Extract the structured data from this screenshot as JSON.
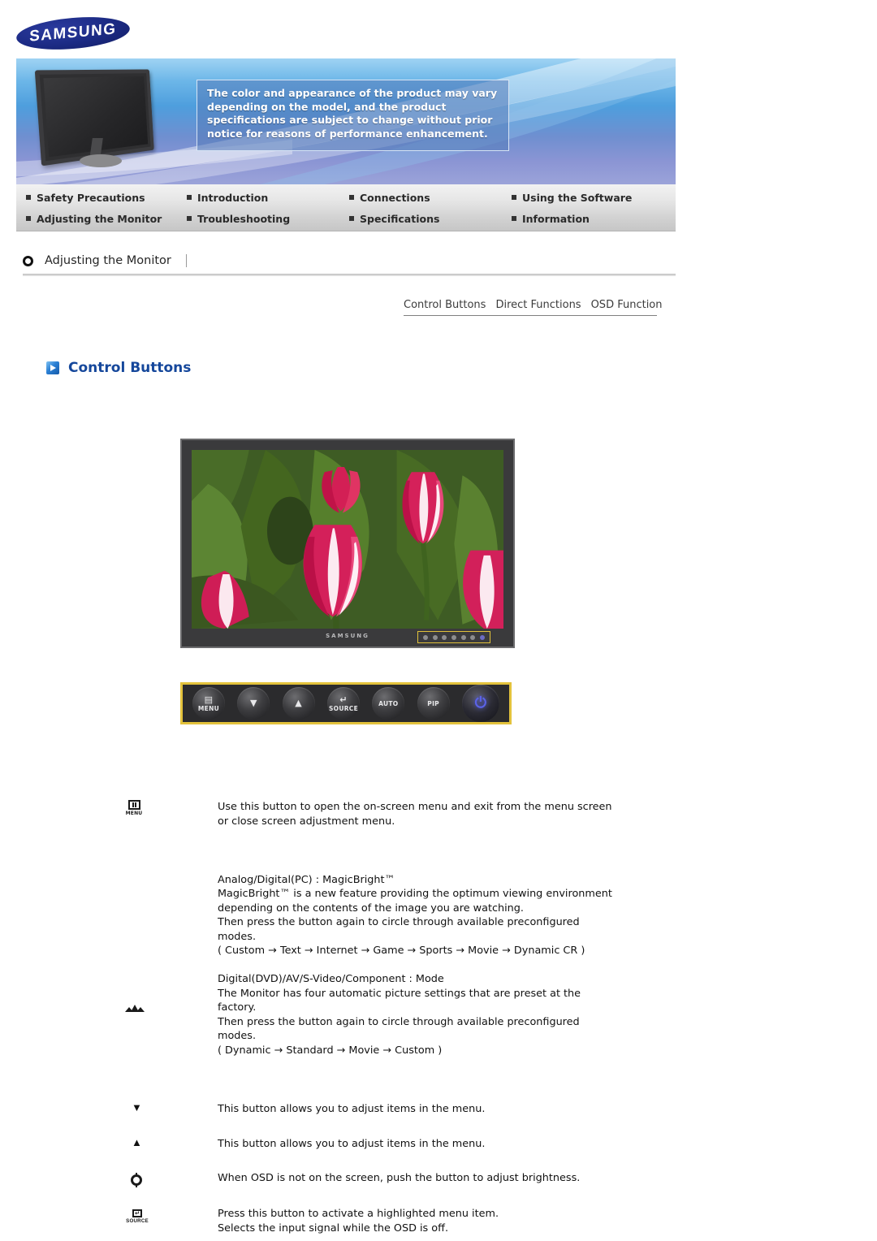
{
  "brand": {
    "logo_text": "SAMSUNG"
  },
  "banner": {
    "notice_lines": [
      "The color and appearance of the product may vary",
      "depending on the model, and the product",
      "specifications are subject to change without prior",
      "notice for reasons of performance enhancement."
    ]
  },
  "topnav": {
    "row1": [
      {
        "label": "Safety Precautions"
      },
      {
        "label": "Introduction"
      },
      {
        "label": "Connections"
      },
      {
        "label": "Using the Software"
      }
    ],
    "row2": [
      {
        "label": "Adjusting the Monitor"
      },
      {
        "label": "Troubleshooting"
      },
      {
        "label": "Specifications"
      },
      {
        "label": "Information"
      }
    ]
  },
  "section": {
    "title": "Adjusting the Monitor"
  },
  "subtabs": [
    {
      "label": "Control Buttons"
    },
    {
      "label": "Direct Functions"
    },
    {
      "label": "OSD Function"
    }
  ],
  "page": {
    "heading": "Control Buttons"
  },
  "monitor_photo": {
    "brand_label": "SAMSUNG"
  },
  "control_panel": {
    "buttons": [
      {
        "name": "menu",
        "glyph": "▤",
        "label": "MENU"
      },
      {
        "name": "down",
        "glyph": "▼",
        "label": ""
      },
      {
        "name": "up",
        "glyph": "▲",
        "label": ""
      },
      {
        "name": "source",
        "glyph": "↵",
        "label": "SOURCE"
      },
      {
        "name": "auto",
        "glyph": "",
        "label": "AUTO"
      },
      {
        "name": "pip",
        "glyph": "",
        "label": "PIP"
      },
      {
        "name": "power",
        "glyph": "⏻",
        "label": ""
      }
    ]
  },
  "descriptions": [
    {
      "icon": "menu-icon",
      "icon_label": "MENU",
      "lines": [
        "Use this button to open the on-screen menu and exit from the menu screen",
        "or close screen adjustment menu."
      ]
    },
    {
      "icon": "magicbright-icon",
      "block1": [
        "Analog/Digital(PC) : MagicBright™",
        "MagicBright™ is a new feature providing the optimum viewing environment",
        "depending on the contents of the image you are watching.",
        "Then press the button again to circle through available preconfigured",
        "modes.",
        "( Custom → Text → Internet → Game → Sports → Movie → Dynamic CR )"
      ],
      "block2": [
        "Digital(DVD)/AV/S-Video/Component : Mode",
        "The Monitor has four automatic picture settings that are preset at the",
        "factory.",
        "Then press the button again to circle through available preconfigured",
        "modes.",
        "( Dynamic → Standard → Movie → Custom )"
      ]
    },
    {
      "icon": "down-triangle-icon",
      "glyph": "▼",
      "lines": [
        "This button allows you to adjust items in the menu."
      ]
    },
    {
      "icon": "up-triangle-icon",
      "glyph": "▲",
      "lines": [
        "This button allows you to adjust items in the menu."
      ]
    },
    {
      "icon": "brightness-icon",
      "lines": [
        "When OSD is not on the screen, push the button to adjust brightness."
      ]
    },
    {
      "icon": "source-icon",
      "icon_label": "SOURCE",
      "lines": [
        "Press this button to activate a highlighted menu item.",
        "Selects the input signal while the OSD is off."
      ]
    }
  ],
  "colors": {
    "heading_blue": "#15479b",
    "logo_blue": "#1b2a83",
    "highlight_yellow": "#e3c23c"
  }
}
